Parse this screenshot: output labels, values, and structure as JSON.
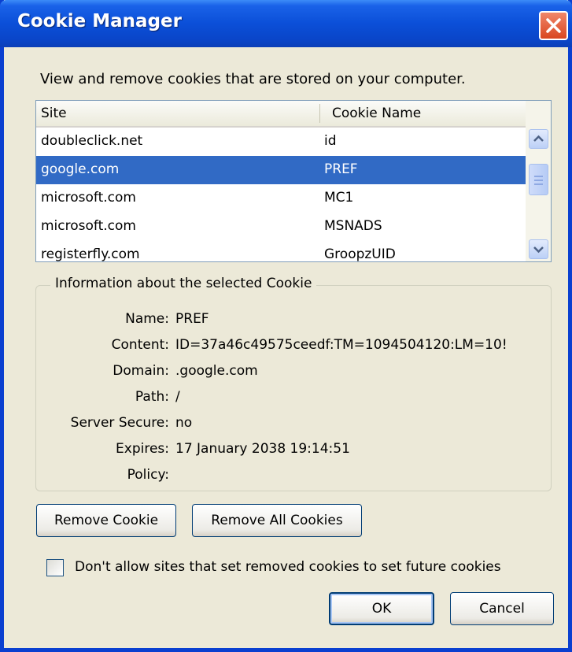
{
  "window": {
    "title": "Cookie Manager"
  },
  "description": "View and remove cookies that are stored on your computer.",
  "list": {
    "columns": [
      "Site",
      "Cookie Name"
    ],
    "rows": [
      {
        "site": "doubleclick.net",
        "cookie": "id"
      },
      {
        "site": "google.com",
        "cookie": "PREF"
      },
      {
        "site": "microsoft.com",
        "cookie": "MC1"
      },
      {
        "site": "microsoft.com",
        "cookie": "MSNADS"
      },
      {
        "site": "registerfly.com",
        "cookie": "GroopzUID"
      }
    ],
    "selected_index": 1
  },
  "info": {
    "legend": "Information about the selected Cookie",
    "fields": [
      {
        "label": "Name:",
        "value": "PREF"
      },
      {
        "label": "Content:",
        "value": "ID=37a46c49575ceedf:TM=1094504120:LM=10!"
      },
      {
        "label": "Domain:",
        "value": ".google.com"
      },
      {
        "label": "Path:",
        "value": "/"
      },
      {
        "label": "Server Secure:",
        "value": "no"
      },
      {
        "label": "Expires:",
        "value": "17 January 2038 19:14:51"
      },
      {
        "label": "Policy:",
        "value": ""
      }
    ]
  },
  "buttons": {
    "remove_cookie": "Remove Cookie",
    "remove_all": "Remove All Cookies",
    "ok": "OK",
    "cancel": "Cancel"
  },
  "checkbox": {
    "label": "Don't allow sites that set removed cookies to set future cookies",
    "checked": false
  },
  "colors": {
    "titlebar": "#0a4fd8",
    "selection": "#316ac5",
    "dialog_bg": "#ece9d8",
    "close": "#d9461f"
  }
}
